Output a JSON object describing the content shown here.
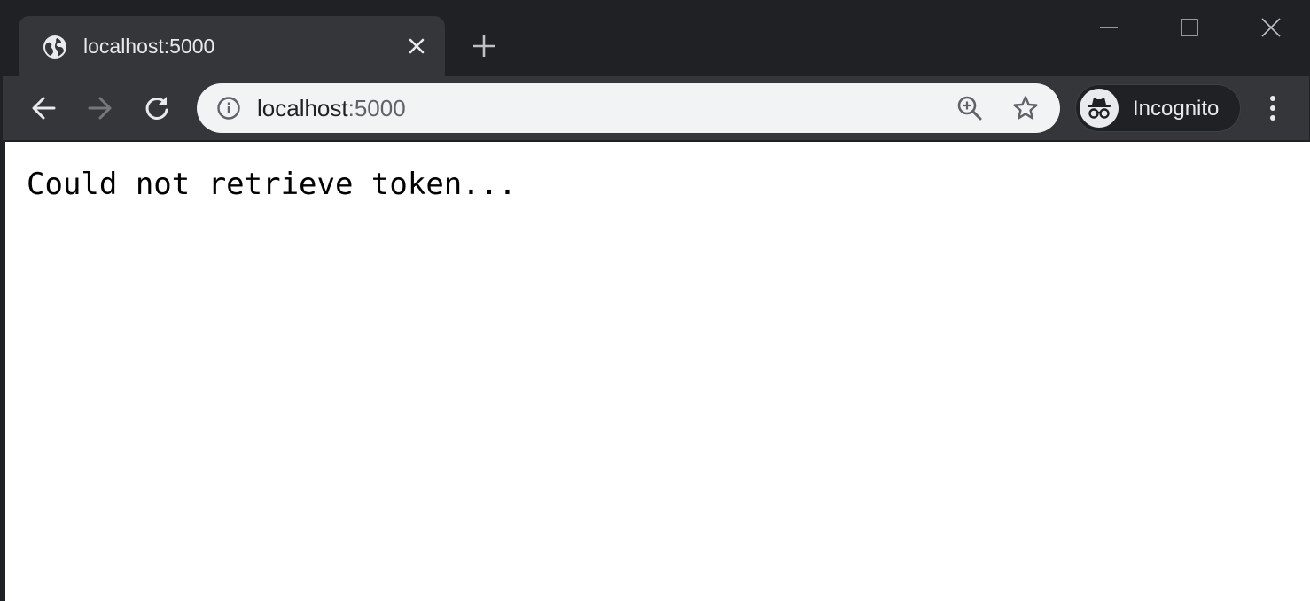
{
  "browser": {
    "tab": {
      "title": "localhost:5000",
      "favicon": "globe-icon"
    },
    "address_bar": {
      "host": "localhost",
      "port": ":5000"
    },
    "profile": {
      "label": "Incognito",
      "icon": "incognito-icon"
    },
    "colors": {
      "frame": "#202124",
      "toolbar": "#35363a",
      "omnibox": "#f1f3f4"
    }
  },
  "page": {
    "message": "Could not retrieve token..."
  }
}
